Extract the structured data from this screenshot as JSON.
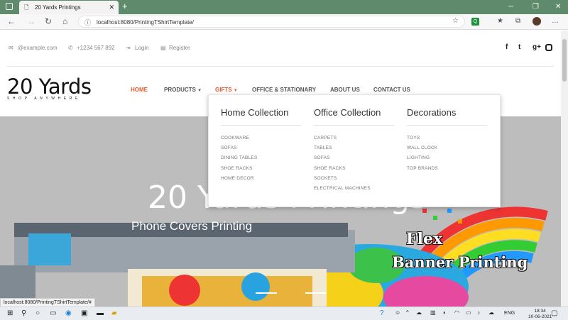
{
  "browser": {
    "tab_title": "20 Yards Printings",
    "url": "localhost:8080/PrintingTShirtTemplate/",
    "status_url": "localhost:8080/PrintingTShirtTemplate/#"
  },
  "topbar": {
    "email": "@example.com",
    "phone": "+1234 567 892",
    "login": "Login",
    "register": "Register"
  },
  "brand": {
    "name": "20 Yards",
    "tagline": "SHOP ANYWHERE"
  },
  "nav": {
    "home": "HOME",
    "products": "PRODUCTS",
    "gifts": "GIFTS",
    "office": "OFFICE & STATIONARY",
    "about": "ABOUT US",
    "contact": "CONTACT US"
  },
  "dropdown": {
    "columns": [
      {
        "title": "Home Collection",
        "items": [
          "COOKWARE",
          "SOFAS",
          "DINING TABLES",
          "SHOE RACKS",
          "HOME DECOR"
        ]
      },
      {
        "title": "Office Collection",
        "items": [
          "CARPETS",
          "TABLES",
          "SOFAS",
          "SHOE RACKS",
          "SOCKETS",
          "ELECTRICAL MACHINES"
        ]
      },
      {
        "title": "Decorations",
        "items": [
          "TOYS",
          "WALL CLOCK",
          "LIGHTING",
          "TOP BRANDS"
        ]
      }
    ]
  },
  "hero": {
    "title": "20 Yards Printings",
    "subtitle": "Phone Covers Printing",
    "banner_line1": "Flex",
    "banner_line2": "Banner Printing"
  },
  "taskbar": {
    "lang": "ENG",
    "time": "18:34",
    "date": "10-06-2021"
  },
  "colors": {
    "accent": "#e05a2b",
    "tabbar": "#5f8a6c"
  }
}
